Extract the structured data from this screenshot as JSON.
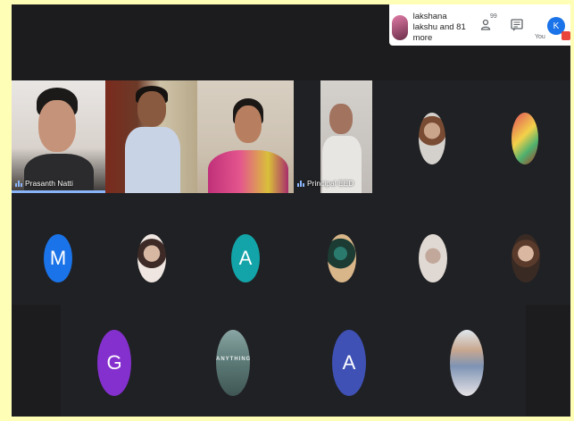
{
  "notification": {
    "text": "lakshana lakshu and 81 more"
  },
  "controls": {
    "people_count": "99",
    "you_initial": "K",
    "you_label": "You"
  },
  "video_tiles": [
    {
      "name": "Prasanth Natti",
      "active": true
    },
    {
      "name": ""
    },
    {
      "name": ""
    },
    {
      "name": "Principal EED"
    }
  ],
  "participants_row1": [
    {
      "type": "photo",
      "icon": "participant-photo"
    },
    {
      "type": "photo",
      "icon": "participant-photo"
    }
  ],
  "participants_row2": [
    {
      "type": "letter",
      "letter": "M",
      "color": "#1a73e8"
    },
    {
      "type": "photo"
    },
    {
      "type": "letter",
      "letter": "A",
      "color": "#12a4a8"
    },
    {
      "type": "photo"
    },
    {
      "type": "photo"
    },
    {
      "type": "photo"
    }
  ],
  "participants_row3": [
    {
      "type": "letter",
      "letter": "G",
      "color": "#8430ce"
    },
    {
      "type": "photo",
      "caption": "ANYTHING"
    },
    {
      "type": "letter",
      "letter": "A",
      "color": "#3f51b5"
    },
    {
      "type": "photo"
    }
  ],
  "colors": {
    "background": "#1c1c1e",
    "tile": "#202124",
    "accent": "#8ab4f8",
    "frame": "#fffeb6"
  }
}
